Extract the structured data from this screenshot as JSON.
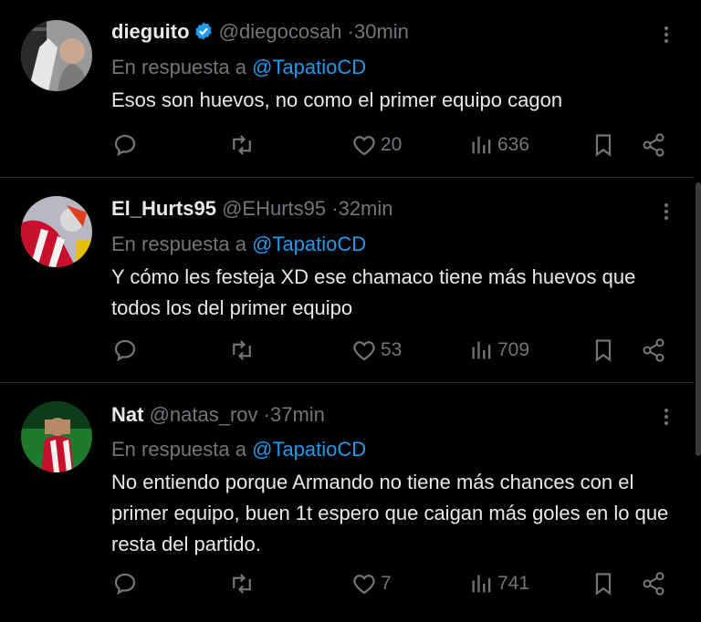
{
  "colors": {
    "background": "#000000",
    "text": "#e7e9ea",
    "muted": "#71767b",
    "link": "#1d9bf0",
    "verified": "#1d9bf0",
    "border": "#2f3336"
  },
  "icons": [
    "verified-badge-icon",
    "more-icon",
    "reply-icon",
    "retweet-icon",
    "like-icon",
    "views-icon",
    "bookmark-icon",
    "share-icon"
  ],
  "tweets": [
    {
      "name": "dieguito",
      "verified": true,
      "handle": "@diegocosah",
      "dot": "·",
      "time": "30min",
      "reply_prefix": "En respuesta a",
      "reply_to": "@TapatioCD",
      "text": "Esos son huevos, no como el primer equipo cagon",
      "likes": "20",
      "views": "636"
    },
    {
      "name": "El_Hurts95",
      "verified": false,
      "handle": "@EHurts95",
      "dot": "·",
      "time": "32min",
      "reply_prefix": "En respuesta a",
      "reply_to": "@TapatioCD",
      "text": "Y cómo les festeja XD ese chamaco tiene más huevos que todos los del primer equipo",
      "likes": "53",
      "views": "709"
    },
    {
      "name": "Nat",
      "verified": false,
      "handle": "@natas_rov",
      "dot": "·",
      "time": "37min",
      "reply_prefix": "En respuesta a",
      "reply_to": "@TapatioCD",
      "text": "No entiendo porque Armando no tiene más chances con el primer equipo, buen 1t espero que caigan más goles en lo que resta del partido.",
      "likes": "7",
      "views": "741"
    }
  ]
}
